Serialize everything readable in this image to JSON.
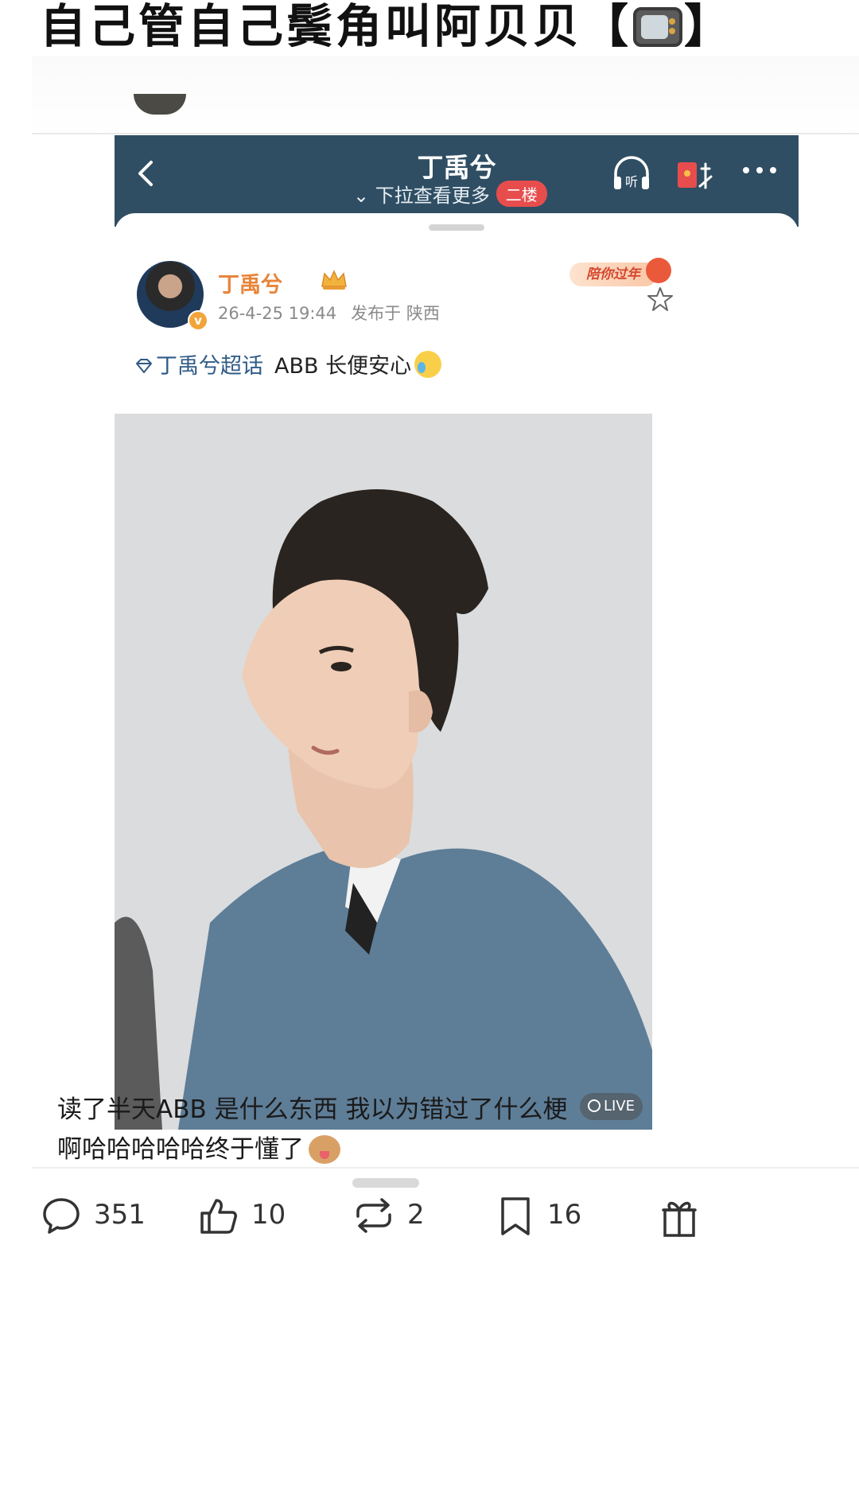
{
  "post": {
    "title": "自己管自己鬓角叫阿贝贝【",
    "title_icon": "tv-icon",
    "title_end": "】"
  },
  "screenshot": {
    "header": {
      "title": "丁禹兮",
      "subtitle": "⌄ 下拉查看更多",
      "floor_badge": "二楼"
    },
    "weibo": {
      "user_name": "丁禹兮",
      "time": "26-4-25 19:44",
      "source": "发布于 陕西",
      "festival_badge": "陪你过年",
      "topic": "丁禹兮超话",
      "text": "ABB 长便安心",
      "live_label": "LIVE"
    }
  },
  "comment": {
    "line1": "读了半天ABB 是什么东西 我以为错过了什么梗",
    "line2": "啊哈哈哈哈哈终于懂了"
  },
  "actions": {
    "comments": "351",
    "likes": "10",
    "reposts": "2",
    "favorites": "16"
  },
  "colors": {
    "header_bg": "#2f4e63",
    "username": "#e8843a",
    "topic": "#2f5b86",
    "floor_badge": "#e74d4d"
  }
}
